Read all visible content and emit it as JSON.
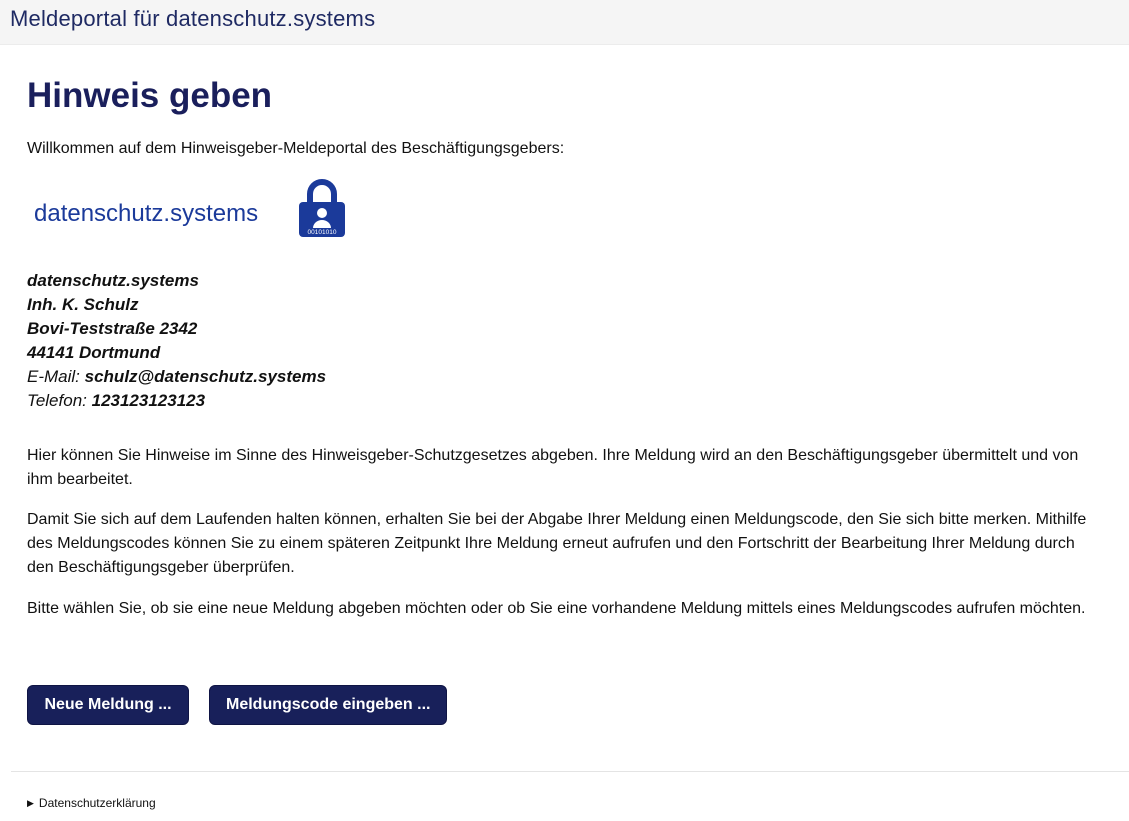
{
  "header": {
    "title": "Meldeportal für datenschutz.systems"
  },
  "main": {
    "title": "Hinweis geben",
    "welcome": "Willkommen auf dem Hinweisgeber-Meldeportal des Beschäftigungsgebers:",
    "logo": {
      "text": "datenschutz.systems",
      "lock_code": "00101010",
      "icon": "lock-person-icon",
      "color": "#1b3a9a"
    },
    "address": {
      "company": "datenschutz.systems",
      "owner": "Inh. K. Schulz",
      "street": "Bovi-Teststraße 2342",
      "city": "44141 Dortmund",
      "email_label": "E-Mail:",
      "email": "schulz@datenschutz.systems",
      "phone_label": "Telefon:",
      "phone": "123123123123"
    },
    "paragraphs": [
      "Hier können Sie Hinweise im Sinne des Hinweisgeber-Schutzgesetzes abgeben. Ihre Meldung wird an den Beschäftigungsgeber übermittelt und von ihm bearbeitet.",
      "Damit Sie sich auf dem Laufenden halten können, erhalten Sie bei der Abgabe Ihrer Meldung einen Meldungscode, den Sie sich bitte merken. Mithilfe des Meldungscodes können Sie zu einem späteren Zeitpunkt Ihre Meldung erneut aufrufen und den Fortschritt der Bearbeitung Ihrer Meldung durch den Beschäftigungsgeber überprüfen.",
      "Bitte wählen Sie, ob sie eine neue Meldung abgeben möchten oder ob Sie eine vorhandene Meldung mittels eines Meldungscodes aufrufen möchten."
    ],
    "buttons": {
      "new_report": "Neue Meldung ...",
      "enter_code": "Meldungscode eingeben ..."
    }
  },
  "footer": {
    "privacy_toggle": "Datenschutzerklärung",
    "toggle_icon": "disclosure-triangle-icon"
  },
  "colors": {
    "accent": "#1a1f5c",
    "button_bg": "#18205a",
    "header_bg": "#f5f5f5"
  }
}
